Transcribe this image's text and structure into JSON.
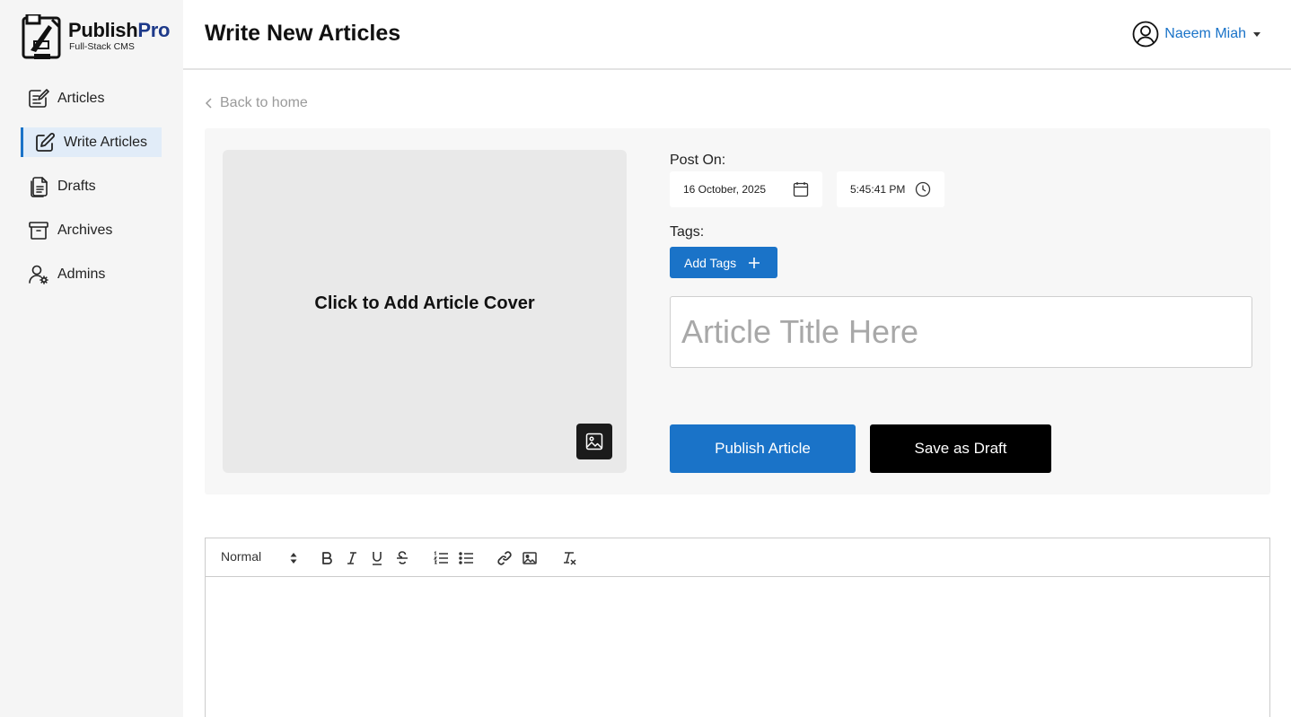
{
  "brand": {
    "name_main": "Publish",
    "name_accent": "Pro",
    "tagline": "Full-Stack CMS",
    "accent_color": "#1e3a8a"
  },
  "sidebar": {
    "items": [
      {
        "label": "Articles",
        "icon": "edit-list-icon",
        "active": false
      },
      {
        "label": "Write Articles",
        "icon": "pencil-square-icon",
        "active": true
      },
      {
        "label": "Drafts",
        "icon": "document-icon",
        "active": false
      },
      {
        "label": "Archives",
        "icon": "archive-box-icon",
        "active": false
      },
      {
        "label": "Admins",
        "icon": "user-gear-icon",
        "active": false
      }
    ]
  },
  "header": {
    "title": "Write New Articles",
    "user_name": "Naeem Miah",
    "user_color": "#1a73c8"
  },
  "back_link": {
    "label": "Back to home"
  },
  "form": {
    "cover_prompt": "Click to Add Article Cover",
    "post_on_label": "Post On:",
    "date_value": "16 October, 2025",
    "time_value": "5:45:41 PM",
    "tags_label": "Tags:",
    "add_tags_label": "Add Tags",
    "title_placeholder": "Article Title Here",
    "title_value": "",
    "publish_label": "Publish Article",
    "draft_label": "Save as Draft",
    "primary_color": "#1a73c8"
  },
  "editor": {
    "heading_select": "Normal",
    "toolbar": [
      "bold-icon",
      "italic-icon",
      "underline-icon",
      "strikethrough-icon",
      "ordered-list-icon",
      "bullet-list-icon",
      "link-icon",
      "image-icon",
      "clear-format-icon"
    ]
  }
}
